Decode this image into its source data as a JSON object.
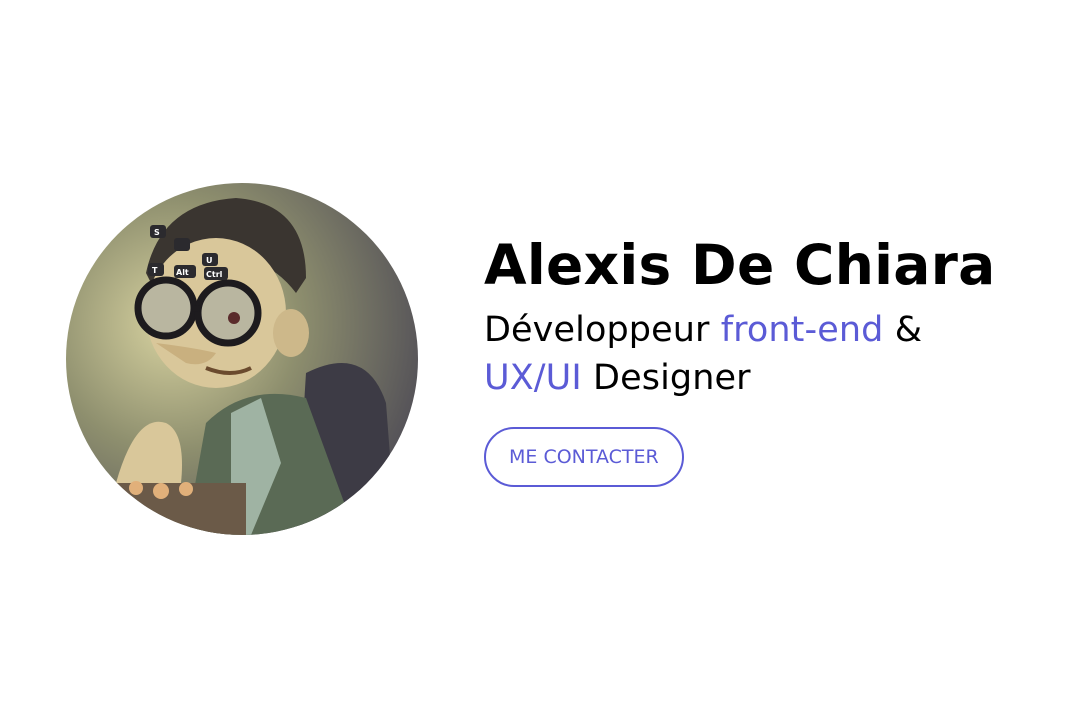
{
  "profile": {
    "name": "Alexis De Chiara",
    "role": {
      "part1": "Développeur ",
      "accent1": "front-end",
      "part2": " & ",
      "accent2": "UX/UI",
      "part3": " Designer"
    },
    "avatar_keys": [
      "S",
      "U",
      "T",
      "Alt",
      "Ctrl"
    ]
  },
  "cta": {
    "label": "ME CONTACTER"
  },
  "colors": {
    "accent": "#5b5bd6",
    "text": "#000000",
    "background": "#ffffff"
  }
}
